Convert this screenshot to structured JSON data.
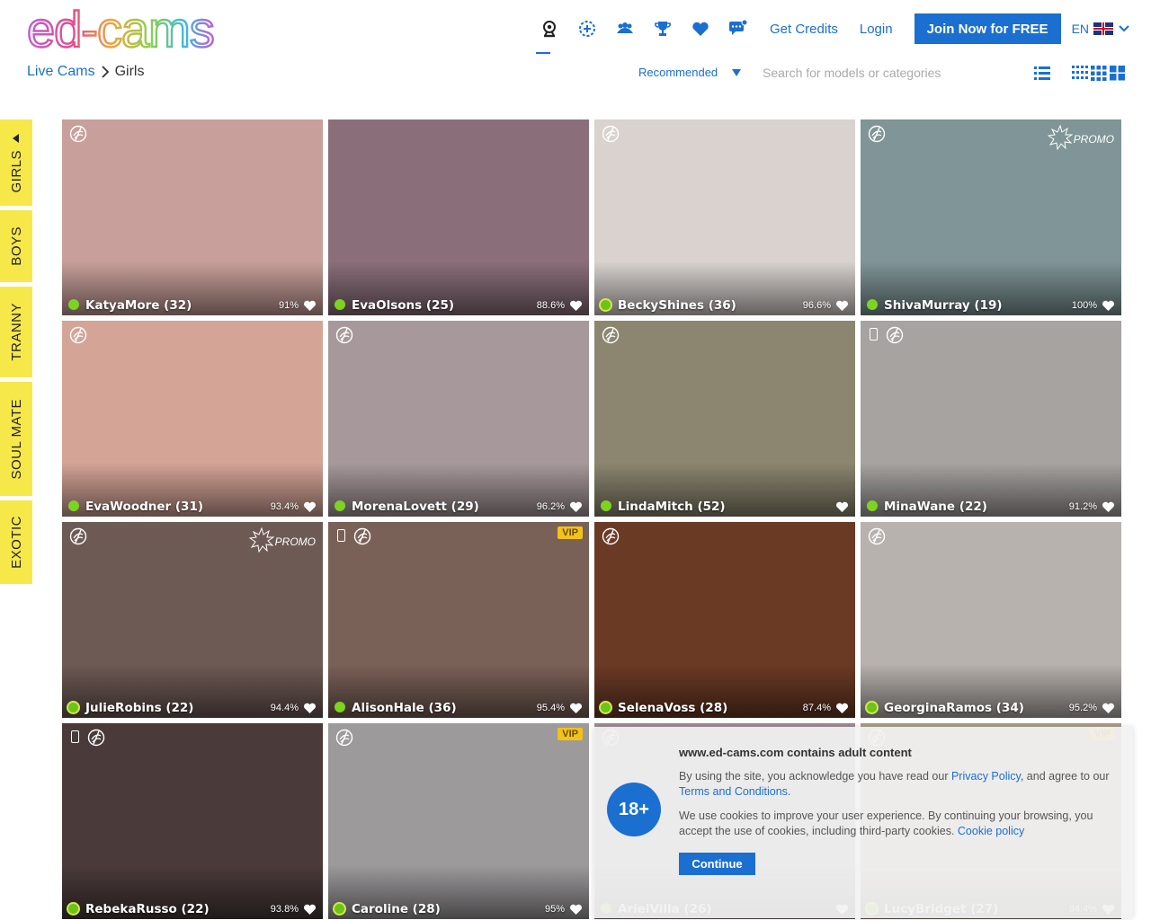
{
  "header": {
    "logo_text": "ed-cams",
    "nav_icons": [
      "webcam-icon",
      "new-models-icon",
      "groups-icon",
      "trophy-icon",
      "favorites-heart-icon",
      "messages-icon"
    ],
    "get_credits": "Get Credits",
    "login": "Login",
    "join": "Join Now for FREE",
    "language": "EN"
  },
  "breadcrumb": {
    "root": "Live Cams",
    "current": "Girls"
  },
  "toolbar": {
    "sort_label": "Recommended",
    "search_placeholder": "Search for models or categories"
  },
  "side_tabs": [
    "GIRLS",
    "BOYS",
    "TRANNY",
    "SOUL MATE",
    "EXOTIC"
  ],
  "cards": [
    {
      "name": "KatyaMore (32)",
      "rating": "91%",
      "status": "online",
      "badge": "",
      "mobile": false,
      "hd": true
    },
    {
      "name": "EvaOlsons (25)",
      "rating": "88.6%",
      "status": "online",
      "badge": "",
      "mobile": false,
      "hd": false
    },
    {
      "name": "BeckyShines (36)",
      "rating": "96.6%",
      "status": "ring",
      "badge": "",
      "mobile": false,
      "hd": true
    },
    {
      "name": "ShivaMurray (19)",
      "rating": "100%",
      "status": "online",
      "badge": "PROMO",
      "mobile": false,
      "hd": true
    },
    {
      "name": "EvaWoodner (31)",
      "rating": "93.4%",
      "status": "online",
      "badge": "",
      "mobile": false,
      "hd": true
    },
    {
      "name": "MorenaLovett (29)",
      "rating": "96.2%",
      "status": "online",
      "badge": "",
      "mobile": false,
      "hd": true
    },
    {
      "name": "LindaMitch (52)",
      "rating": "",
      "status": "online",
      "badge": "",
      "mobile": false,
      "hd": true
    },
    {
      "name": "MinaWane (22)",
      "rating": "91.2%",
      "status": "online",
      "badge": "",
      "mobile": true,
      "hd": true
    },
    {
      "name": "JulieRobins (22)",
      "rating": "94.4%",
      "status": "ring",
      "badge": "PROMO",
      "mobile": false,
      "hd": true
    },
    {
      "name": "AlisonHale (36)",
      "rating": "95.4%",
      "status": "online",
      "badge": "VIP",
      "mobile": true,
      "hd": true
    },
    {
      "name": "SelenaVoss (28)",
      "rating": "87.4%",
      "status": "ring",
      "badge": "",
      "mobile": false,
      "hd": true
    },
    {
      "name": "GeorginaRamos (34)",
      "rating": "95.2%",
      "status": "ring",
      "badge": "",
      "mobile": false,
      "hd": true
    },
    {
      "name": "RebekaRusso (22)",
      "rating": "93.8%",
      "status": "ring",
      "badge": "",
      "mobile": true,
      "hd": true
    },
    {
      "name": "Caroline (28)",
      "rating": "95%",
      "status": "ring",
      "badge": "VIP",
      "mobile": false,
      "hd": true
    },
    {
      "name": "ArielVilla (26)",
      "rating": "",
      "status": "online",
      "badge": "",
      "mobile": false,
      "hd": true
    },
    {
      "name": "LucyBridget (27)",
      "rating": "94.4%",
      "status": "ring",
      "badge": "VIP",
      "mobile": false,
      "hd": true
    }
  ],
  "card_backgrounds": [
    "#c89f9a",
    "#8a6f7a",
    "#d9d2cf",
    "#7f9597",
    "#d4a497",
    "#a7999b",
    "#8c8670",
    "#a7a3a1",
    "#6e5a55",
    "#7a6157",
    "#6b3a25",
    "#b8b2ae",
    "#4a3a3a",
    "#9d9a9c",
    "#9b8c94",
    "#a89e8e"
  ],
  "cookie": {
    "age": "18+",
    "title": "www.ed-cams.com contains adult content",
    "p1_before": "By using the site, you acknowledge you have read our ",
    "privacy_link": "Privacy Policy",
    "p1_after": ", and agree to our ",
    "terms_link": "Terms and Conditions",
    "p1_end": ".",
    "p2_before": "We use cookies to improve your user experience. By continuing your browsing, you accept the use of cookies, including third-party cookies. ",
    "cookie_link": "Cookie policy",
    "button": "Continue"
  },
  "colors": {
    "brand_blue": "#1a6fd1",
    "side_tab_yellow": "#f7e84a",
    "status_green": "#7ed321",
    "vip_gold": "#f2c21a"
  }
}
